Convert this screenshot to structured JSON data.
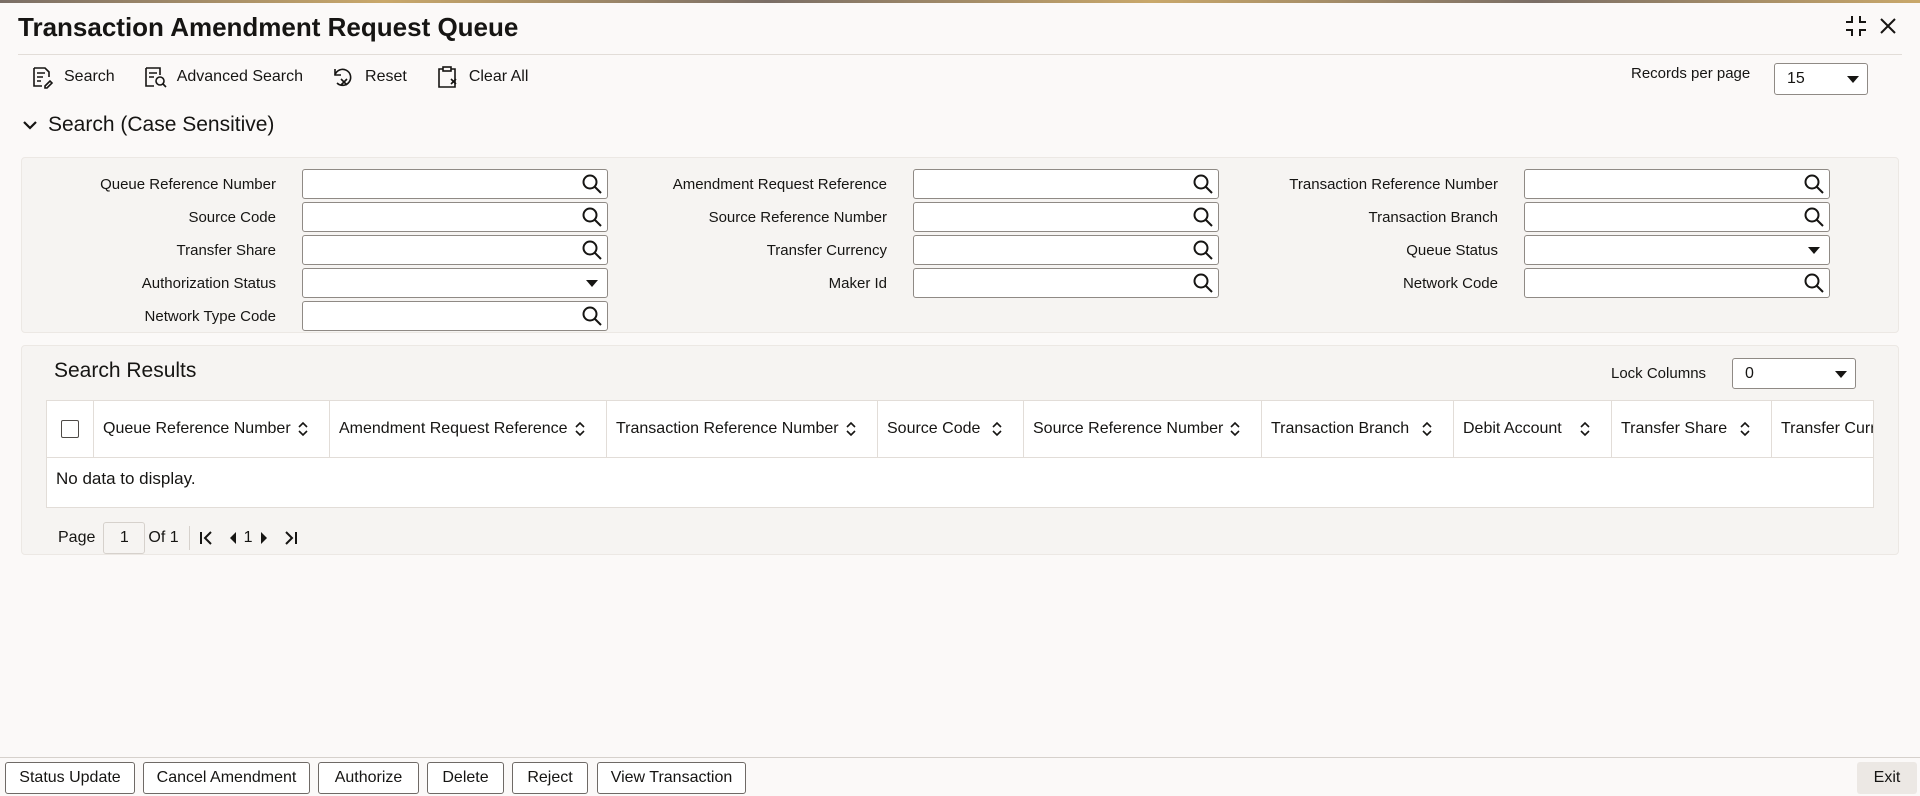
{
  "window": {
    "title": "Transaction Amendment Request Queue",
    "maximize_icon": "maximize-icon",
    "close_icon": "close-icon"
  },
  "toolbar": {
    "search_label": "Search",
    "advanced_search_label": "Advanced Search",
    "reset_label": "Reset",
    "clear_all_label": "Clear All",
    "records_per_page_label": "Records per page",
    "records_per_page_value": "15"
  },
  "search": {
    "section_label": "Search (Case Sensitive)",
    "fields": {
      "queue_reference_number": "Queue Reference Number",
      "amendment_request_reference": "Amendment Request Reference",
      "transaction_reference_number": "Transaction Reference Number",
      "source_code": "Source Code",
      "source_reference_number": "Source Reference Number",
      "transaction_branch": "Transaction Branch",
      "transfer_share": "Transfer Share",
      "transfer_currency": "Transfer Currency",
      "queue_status": "Queue Status",
      "authorization_status": "Authorization Status",
      "maker_id": "Maker Id",
      "network_code": "Network Code",
      "network_type_code": "Network Type Code"
    }
  },
  "results": {
    "title": "Search Results",
    "lock_columns_label": "Lock Columns",
    "lock_columns_value": "0",
    "columns": [
      "Queue Reference Number",
      "Amendment Request Reference",
      "Transaction Reference Number",
      "Source Code",
      "Source Reference Number",
      "Transaction Branch",
      "Debit Account",
      "Transfer Share",
      "Transfer Curre"
    ],
    "empty_message": "No data to display.",
    "pagination": {
      "page_label": "Page",
      "page_value": "1",
      "of_label": "Of 1",
      "current_page": "1"
    }
  },
  "footer": {
    "buttons": [
      "Status Update",
      "Cancel Amendment",
      "Authorize",
      "Delete",
      "Reject",
      "View Transaction"
    ],
    "exit_label": "Exit"
  }
}
